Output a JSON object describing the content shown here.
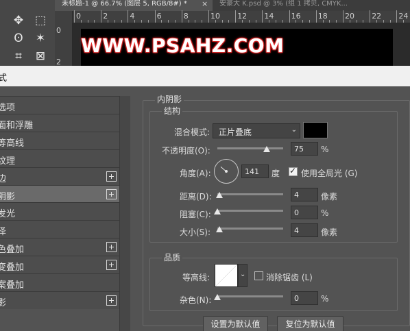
{
  "tabs": {
    "active": "未标题-1 @ 66.7% (图层 5, RGB/8#) *",
    "active_close": "×",
    "inactive": "安豪大 K.psd @ 3% (组 1 拷贝, CMYK..."
  },
  "tools": {
    "move": "✥",
    "marquee": "⬚",
    "lasso": "ʘ",
    "wand": "✶",
    "crop": "⌗",
    "frame": "⊠"
  },
  "ruler": {
    "h_labels": [
      "0",
      "2",
      "4",
      "6",
      "8",
      "10",
      "12",
      "14",
      "16",
      "18",
      "20",
      "22",
      "24"
    ],
    "v_labels": [
      "0",
      "2"
    ]
  },
  "canvas": {
    "text": "WWW.PSAHZ.COM"
  },
  "dialog": {
    "title": "式",
    "sidebar": [
      {
        "label": "选项",
        "plus": false,
        "active": false
      },
      {
        "label": "面和浮雕",
        "plus": false,
        "active": false
      },
      {
        "label": "等高线",
        "plus": false,
        "active": false
      },
      {
        "label": "纹理",
        "plus": false,
        "active": false
      },
      {
        "label": "边",
        "plus": true,
        "active": false
      },
      {
        "label": "阴影",
        "plus": true,
        "active": true
      },
      {
        "label": "发光",
        "plus": false,
        "active": false
      },
      {
        "label": "泽",
        "plus": false,
        "active": false
      },
      {
        "label": "色叠加",
        "plus": true,
        "active": false
      },
      {
        "label": "变叠加",
        "plus": true,
        "active": false
      },
      {
        "label": "案叠加",
        "plus": false,
        "active": false
      },
      {
        "label": "影",
        "plus": true,
        "active": false
      }
    ],
    "section_title": "内阴影",
    "structure": {
      "legend": "结构",
      "blend_mode_label": "混合模式:",
      "blend_mode_value": "正片叠底",
      "blend_color": "#000000",
      "opacity_label": "不透明度(O):",
      "opacity_value": "75",
      "opacity_unit": "%",
      "opacity_fraction": 0.75,
      "angle_label": "角度(A):",
      "angle_value": "141",
      "angle_unit": "度",
      "global_light_label": "使用全局光 (G)",
      "global_light_checked": true,
      "distance_label": "距离(D):",
      "distance_value": "4",
      "distance_unit": "像素",
      "choke_label": "阻塞(C):",
      "choke_value": "0",
      "choke_unit": "%",
      "size_label": "大小(S):",
      "size_value": "4",
      "size_unit": "像素"
    },
    "quality": {
      "legend": "品质",
      "contour_label": "等高线:",
      "antialias_label": "消除锯齿 (L)",
      "antialias_checked": false,
      "noise_label": "杂色(N):",
      "noise_value": "0",
      "noise_unit": "%"
    },
    "buttons": {
      "make_default": "设置为默认值",
      "reset_default": "复位为默认值"
    }
  }
}
